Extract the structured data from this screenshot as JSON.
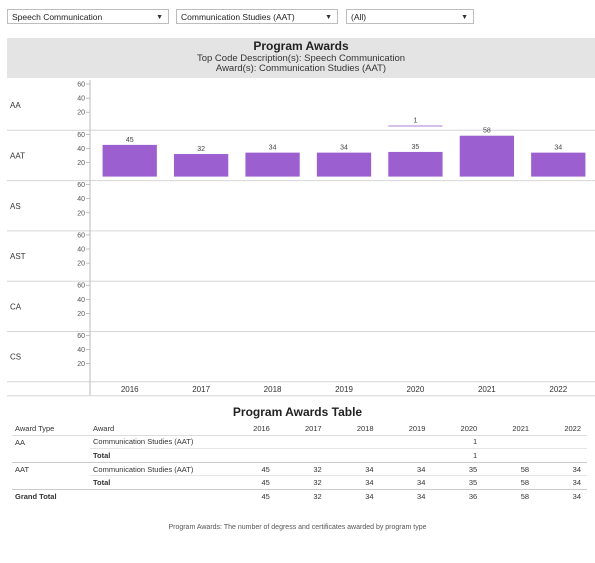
{
  "filters": [
    {
      "value": "Speech Communication"
    },
    {
      "value": "Communication Studies (AAT)"
    },
    {
      "value": "(All)"
    }
  ],
  "chart_data": {
    "type": "bar",
    "title": "Program Awards",
    "subtitle_lines": [
      "Top Code Description(s): Speech Communication",
      "Award(s): Communication Studies (AAT)"
    ],
    "categories": [
      "2016",
      "2017",
      "2018",
      "2019",
      "2020",
      "2021",
      "2022"
    ],
    "rows": [
      "AA",
      "AAT",
      "AS",
      "AST",
      "CA",
      "CS"
    ],
    "y_ticks": [
      "60",
      "40",
      "20"
    ],
    "ylim": [
      0,
      60
    ],
    "bar_color": "#9b5fd0",
    "series": [
      {
        "name": "AA",
        "values": [
          null,
          null,
          null,
          null,
          1,
          null,
          null
        ]
      },
      {
        "name": "AAT",
        "values": [
          45,
          32,
          34,
          34,
          35,
          58,
          34
        ]
      },
      {
        "name": "AS",
        "values": [
          null,
          null,
          null,
          null,
          null,
          null,
          null
        ]
      },
      {
        "name": "AST",
        "values": [
          null,
          null,
          null,
          null,
          null,
          null,
          null
        ]
      },
      {
        "name": "CA",
        "values": [
          null,
          null,
          null,
          null,
          null,
          null,
          null
        ]
      },
      {
        "name": "CS",
        "values": [
          null,
          null,
          null,
          null,
          null,
          null,
          null
        ]
      }
    ]
  },
  "table": {
    "title": "Program Awards Table",
    "headers": {
      "type": "Award Type",
      "award": "Award",
      "years": [
        "2016",
        "2017",
        "2018",
        "2019",
        "2020",
        "2021",
        "2022"
      ]
    },
    "groups": [
      {
        "type": "AA",
        "rows": [
          {
            "award": "Communication Studies (AAT)",
            "values": [
              "",
              "",
              "",
              "",
              "1",
              "",
              ""
            ]
          },
          {
            "award": "Total",
            "values": [
              "",
              "",
              "",
              "",
              "1",
              "",
              ""
            ]
          }
        ]
      },
      {
        "type": "AAT",
        "rows": [
          {
            "award": "Communication Studies (AAT)",
            "values": [
              "45",
              "32",
              "34",
              "34",
              "35",
              "58",
              "34"
            ]
          },
          {
            "award": "Total",
            "values": [
              "45",
              "32",
              "34",
              "34",
              "35",
              "58",
              "34"
            ]
          }
        ]
      }
    ],
    "grand_total": {
      "label": "Grand Total",
      "values": [
        "45",
        "32",
        "34",
        "34",
        "36",
        "58",
        "34"
      ]
    }
  },
  "footnote": "Program Awards: The number of degress and certificates awarded by program type"
}
